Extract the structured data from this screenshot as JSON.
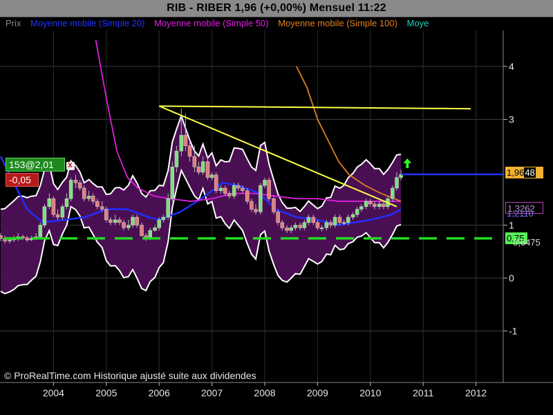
{
  "header": {
    "title": "RIB - RIBER    1,96 (+0,00%)    Mensuel  11:22"
  },
  "legend": [
    {
      "label": "Prix",
      "color": "#8a8a8a"
    },
    {
      "label": "Moyenne mobile (Simple 20)",
      "color": "#2233ff"
    },
    {
      "label": "Moyenne mobile (Simple 50)",
      "color": "#e020e0"
    },
    {
      "label": "Moyenne mobile (Simple 100)",
      "color": "#e08020"
    },
    {
      "label": "Moye",
      "color": "#20d0c0"
    }
  ],
  "order_tag": {
    "label": "153@2,01",
    "close_symbol": "x"
  },
  "pnl_tag": {
    "label": "-0,05"
  },
  "price_labels": {
    "last": "1,9648",
    "last_part1": "1,96",
    "last_part2": "48",
    "ma": "1,3262",
    "ma_hidden": "1,2110",
    "support": "0,75",
    "support_hidden": "0,6475"
  },
  "copyright": "© ProRealTime.com Historique ajusté suite aux dividendes",
  "chart_data": {
    "type": "candlestick",
    "title": "RIB - RIBER",
    "x_ticks": [
      "2004",
      "2005",
      "2006",
      "2007",
      "2008",
      "2009",
      "2010",
      "2011",
      "2012"
    ],
    "y_ticks": [
      "4",
      "3",
      "1",
      "0",
      "-1"
    ],
    "y_range": [
      -1.9,
      4.7
    ],
    "grid": true,
    "series": [
      {
        "name": "Prix",
        "kind": "candles",
        "x": [
          2003.0,
          2003.08,
          2003.17,
          2003.25,
          2003.33,
          2003.42,
          2003.5,
          2003.58,
          2003.67,
          2003.75,
          2003.83,
          2003.92,
          2004.0,
          2004.08,
          2004.17,
          2004.25,
          2004.33,
          2004.42,
          2004.5,
          2004.58,
          2004.67,
          2004.75,
          2004.83,
          2004.92,
          2005.0,
          2005.08,
          2005.17,
          2005.25,
          2005.33,
          2005.42,
          2005.5,
          2005.58,
          2005.67,
          2005.75,
          2005.83,
          2005.92,
          2006.0,
          2006.08,
          2006.17,
          2006.25,
          2006.33,
          2006.42,
          2006.5,
          2006.58,
          2006.67,
          2006.75,
          2006.83,
          2006.92,
          2007.0,
          2007.08,
          2007.17,
          2007.25,
          2007.33,
          2007.42,
          2007.5,
          2007.58,
          2007.67,
          2007.75,
          2007.83,
          2007.92,
          2008.0,
          2008.08,
          2008.17,
          2008.25,
          2008.33,
          2008.42,
          2008.5,
          2008.58,
          2008.67,
          2008.75,
          2008.83,
          2008.92,
          2009.0,
          2009.08,
          2009.17,
          2009.25,
          2009.33,
          2009.42,
          2009.5,
          2009.58,
          2009.67,
          2009.75,
          2009.83,
          2009.92,
          2010.0,
          2010.08,
          2010.17,
          2010.25,
          2010.33,
          2010.42,
          2010.5,
          2010.58
        ],
        "open": [
          0.8,
          0.75,
          0.7,
          0.72,
          0.74,
          0.78,
          0.76,
          0.72,
          0.75,
          0.78,
          1.0,
          1.35,
          1.5,
          1.2,
          1.15,
          1.35,
          1.5,
          1.85,
          1.8,
          1.7,
          1.5,
          1.55,
          1.45,
          1.35,
          1.3,
          1.1,
          1.05,
          1.1,
          1.05,
          0.95,
          1.0,
          1.15,
          1.0,
          0.8,
          0.75,
          0.9,
          0.95,
          1.1,
          1.15,
          1.5,
          2.1,
          2.4,
          2.7,
          2.5,
          2.3,
          2.1,
          2.0,
          2.2,
          1.9,
          1.95,
          1.65,
          1.7,
          1.6,
          1.55,
          1.75,
          1.7,
          1.65,
          1.45,
          1.3,
          1.25,
          1.75,
          1.85,
          1.5,
          1.25,
          1.05,
          0.95,
          0.9,
          0.95,
          1.0,
          0.95,
          1.05,
          1.15,
          1.05,
          0.95,
          0.95,
          1.05,
          1.0,
          1.15,
          1.05,
          1.05,
          1.15,
          1.2,
          1.3,
          1.35,
          1.45,
          1.4,
          1.35,
          1.4,
          1.35,
          1.5,
          1.7,
          1.9
        ],
        "close": [
          0.75,
          0.7,
          0.72,
          0.74,
          0.78,
          0.76,
          0.72,
          0.75,
          0.78,
          1.0,
          1.35,
          1.5,
          1.2,
          1.15,
          1.35,
          1.5,
          1.85,
          1.8,
          1.7,
          1.5,
          1.55,
          1.45,
          1.35,
          1.3,
          1.1,
          1.05,
          1.1,
          1.05,
          0.95,
          1.0,
          1.15,
          1.0,
          0.8,
          0.75,
          0.9,
          0.95,
          1.1,
          1.15,
          1.5,
          2.1,
          2.4,
          2.7,
          2.5,
          2.3,
          2.1,
          2.0,
          2.2,
          1.9,
          1.95,
          1.65,
          1.7,
          1.6,
          1.55,
          1.75,
          1.7,
          1.65,
          1.45,
          1.3,
          1.25,
          1.75,
          1.85,
          1.5,
          1.25,
          1.05,
          0.95,
          0.9,
          0.95,
          1.0,
          0.95,
          1.05,
          1.15,
          1.05,
          0.95,
          0.95,
          1.05,
          1.0,
          1.15,
          1.05,
          1.05,
          1.15,
          1.2,
          1.3,
          1.35,
          1.45,
          1.4,
          1.35,
          1.4,
          1.35,
          1.5,
          1.7,
          1.9,
          1.96
        ],
        "high": [
          0.85,
          0.8,
          0.78,
          0.8,
          0.85,
          0.82,
          0.8,
          0.8,
          0.85,
          1.05,
          1.4,
          1.6,
          1.55,
          1.3,
          1.4,
          1.6,
          1.9,
          1.95,
          1.85,
          1.75,
          1.65,
          1.6,
          1.5,
          1.45,
          1.35,
          1.15,
          1.2,
          1.15,
          1.1,
          1.1,
          1.2,
          1.2,
          1.05,
          0.85,
          0.95,
          1.0,
          1.15,
          1.2,
          1.6,
          2.2,
          2.5,
          3.2,
          3.1,
          2.6,
          2.5,
          2.2,
          2.3,
          2.3,
          2.0,
          2.0,
          1.75,
          1.75,
          1.65,
          1.8,
          1.8,
          1.75,
          1.7,
          1.5,
          1.4,
          1.8,
          1.9,
          1.9,
          1.55,
          1.3,
          1.1,
          1.0,
          1.0,
          1.05,
          1.05,
          1.1,
          1.2,
          1.2,
          1.1,
          1.0,
          1.1,
          1.1,
          1.2,
          1.2,
          1.1,
          1.2,
          1.25,
          1.35,
          1.4,
          1.5,
          1.5,
          1.45,
          1.45,
          1.45,
          1.55,
          1.75,
          2.0,
          2.05
        ],
        "low": [
          0.7,
          0.65,
          0.65,
          0.68,
          0.7,
          0.72,
          0.68,
          0.7,
          0.72,
          0.75,
          0.95,
          1.3,
          1.15,
          1.1,
          1.1,
          1.3,
          1.45,
          1.7,
          1.65,
          1.45,
          1.45,
          1.4,
          1.3,
          1.25,
          1.05,
          1.0,
          1.0,
          1.0,
          0.9,
          0.9,
          0.95,
          0.95,
          0.78,
          0.7,
          0.72,
          0.88,
          0.9,
          1.05,
          1.1,
          1.45,
          2.0,
          2.3,
          2.4,
          2.2,
          2.0,
          1.95,
          1.95,
          1.85,
          1.85,
          1.6,
          1.6,
          1.55,
          1.5,
          1.5,
          1.65,
          1.6,
          1.4,
          1.25,
          1.2,
          1.2,
          1.7,
          1.45,
          1.2,
          1.0,
          0.9,
          0.85,
          0.85,
          0.9,
          0.9,
          0.9,
          1.0,
          1.0,
          0.9,
          0.88,
          0.9,
          0.95,
          0.95,
          1.0,
          1.0,
          1.0,
          1.1,
          1.15,
          1.25,
          1.3,
          1.35,
          1.3,
          1.3,
          1.3,
          1.3,
          1.45,
          1.65,
          1.85
        ]
      },
      {
        "name": "Moyenne mobile (Simple 20)",
        "kind": "line",
        "x": [
          2003.0,
          2003.5,
          2003.8,
          2004.2,
          2004.6,
          2005.0,
          2005.4,
          2005.8,
          2006.0,
          2006.4,
          2006.8,
          2007.2,
          2007.5,
          2007.9,
          2008.2,
          2008.6,
          2009.0,
          2009.4,
          2009.7,
          2010.0,
          2010.4,
          2010.58
        ],
        "y": [
          2.3,
          1.3,
          1.05,
          1.1,
          1.15,
          1.3,
          1.3,
          1.15,
          1.1,
          1.25,
          1.5,
          1.8,
          1.75,
          1.6,
          1.3,
          1.15,
          1.1,
          1.0,
          1.05,
          1.1,
          1.2,
          1.3
        ]
      },
      {
        "name": "Moyenne mobile (Simple 50)",
        "kind": "line",
        "x": [
          2004.8,
          2005.0,
          2005.2,
          2005.4,
          2005.6,
          2005.9,
          2006.2,
          2006.6,
          2007.0,
          2007.4,
          2007.8,
          2008.2,
          2008.6,
          2009.0,
          2009.4,
          2009.8,
          2010.2,
          2010.58
        ],
        "y": [
          4.5,
          3.4,
          2.4,
          1.9,
          1.7,
          1.55,
          1.5,
          1.45,
          1.5,
          1.6,
          1.6,
          1.55,
          1.5,
          1.5,
          1.45,
          1.45,
          1.45,
          1.45
        ]
      },
      {
        "name": "Moyenne mobile (Simple 100)",
        "kind": "line",
        "x": [
          2008.6,
          2008.8,
          2009.0,
          2009.2,
          2009.4,
          2009.6,
          2009.9,
          2010.2,
          2010.58
        ],
        "y": [
          4.0,
          3.6,
          3.0,
          2.6,
          2.2,
          1.95,
          1.75,
          1.6,
          1.45
        ]
      }
    ],
    "horizontal_lines": [
      {
        "label": "1,96",
        "y": 1.96,
        "color": "#2233ff"
      },
      {
        "label": "0,75",
        "y": 0.75,
        "color": "#22dd22",
        "dashed": true
      }
    ],
    "trend_lines": [
      {
        "x": [
          2006.0,
          2011.9
        ],
        "y": [
          3.25,
          3.2
        ],
        "color": "#ffff44"
      },
      {
        "x": [
          2006.0,
          2010.5
        ],
        "y": [
          3.25,
          1.35
        ],
        "color": "#ffff44"
      }
    ]
  }
}
